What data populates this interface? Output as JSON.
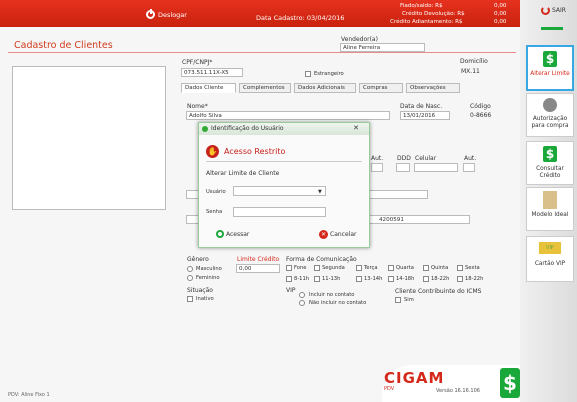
{
  "topbar": {
    "logout_label": "Deslogar",
    "date_text": "Data Cadastro: 03/04/2016",
    "stats": [
      {
        "label": "Fiado/saldo: R$",
        "value": "0,00"
      },
      {
        "label": "Crédito Devolução: R$",
        "value": "0,00"
      },
      {
        "label": "Crédito Adiantamento: R$",
        "value": "0,00"
      }
    ]
  },
  "sidebar": {
    "sair_label": "SAIR",
    "buttons": [
      {
        "label": "Alterar Limite",
        "icon": "dollar-icon"
      },
      {
        "label": "Autorização para compra",
        "icon": "user-icon"
      },
      {
        "label": "Consultar Crédito",
        "icon": "dollar-icon"
      },
      {
        "label": "Modelo Ideal",
        "icon": "book-icon"
      },
      {
        "label": "Cartão VIP",
        "icon": "vip-card-icon"
      }
    ]
  },
  "page": {
    "title": "Cadastro de Clientes",
    "cpf_label": "CPF/CNPJ*",
    "cpf_value": "073.511.11X-X5",
    "vendedor_label": "Vendedor(a)",
    "vendedor_value": "Aline Ferreira",
    "domicilio_label": "Domicílio",
    "domicilio_value": "MX.11",
    "estrangeiro_label": "Estrangeiro"
  },
  "tabs": [
    {
      "label": "Dados Cliente"
    },
    {
      "label": "Complementos"
    },
    {
      "label": "Dados Adicionais"
    },
    {
      "label": "Compras"
    },
    {
      "label": "Observações"
    }
  ],
  "form": {
    "nome_label": "Nome*",
    "nome_value": "Adolfo Silva",
    "nasc_label": "Data de Nasc.",
    "nasc_value": "13/01/2016",
    "codigo_label": "Código",
    "codigo_value": "0-8666",
    "aut_label": "Aut.",
    "ddd_label": "DDD",
    "celular_label": "Celular",
    "aut2_label": "Aut.",
    "bank_value": "4200591",
    "genero_label": "Gênero",
    "masculino_label": "Masculino",
    "feminino_label": "Feminino",
    "limite_label": "Limite Crédito",
    "limite_value": "0,00",
    "comunicacao_label": "Forma de Comunicação",
    "days": [
      "Fone",
      "Segunda",
      "Terça",
      "Quarta",
      "Quinta",
      "Sexta"
    ],
    "hours": [
      "8-11h",
      "11-13h",
      "13-14h",
      "14-18h",
      "18-22h",
      "18-22h"
    ],
    "situacao_label": "Situação",
    "inativo_label": "Inativo",
    "vip_label": "VIP",
    "vip_opt1": "Incluir no contato",
    "vip_opt2": "Não incluir no contato",
    "icms_label": "Cliente Contribuinte do ICMS",
    "icms_opt": "Sim"
  },
  "modal": {
    "title": "Identificação do Usuário",
    "restrito": "Acesso Restrito",
    "subtitle": "Alterar Limite de Cliente",
    "usuario_label": "Usuário",
    "usuario_value": "",
    "senha_label": "Senha",
    "acessar_label": "Acessar",
    "cancelar_label": "Cancelar"
  },
  "footer": {
    "brand": "CIGAM",
    "brand_sub": "PDV",
    "version": "Versão 16.16.106",
    "status": "PDV: Aline   Fixo 1"
  },
  "colors": {
    "accent": "#d4281a",
    "green": "#1aa83a"
  }
}
